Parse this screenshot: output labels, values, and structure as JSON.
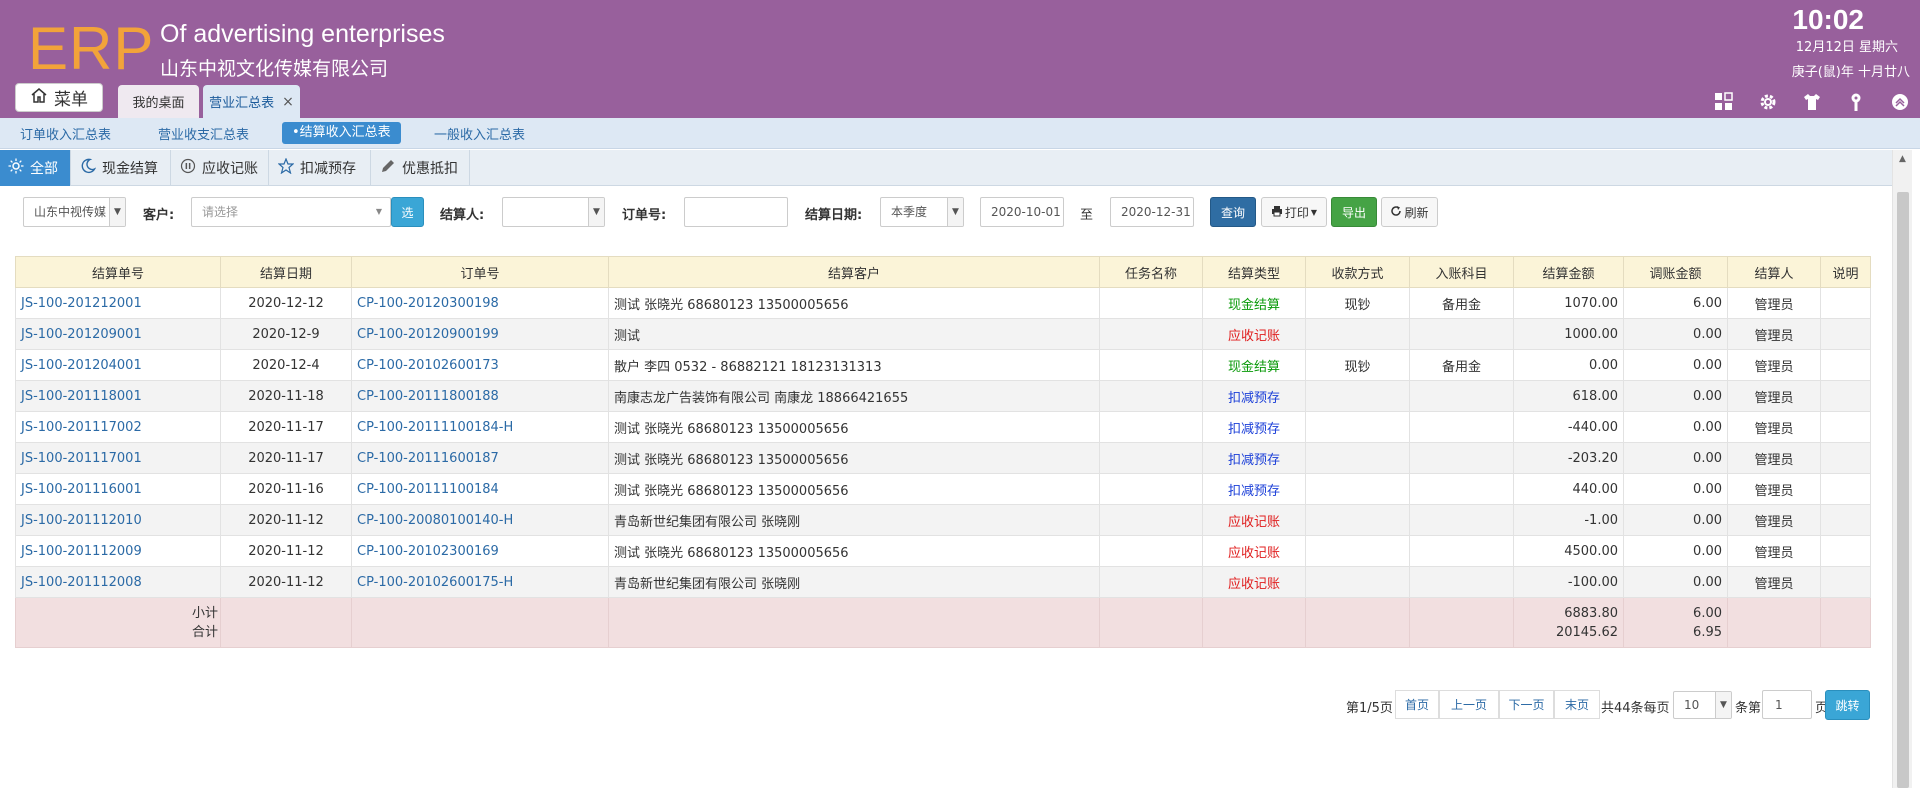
{
  "header": {
    "logo": "ERP",
    "company_en": "Of advertising enterprises",
    "company_cn": "山东中视文化传媒有限公司",
    "time": "10:02",
    "date": "12月12日 星期六",
    "lunar": "庚子(鼠)年 十月廿八",
    "menu_label": "菜单",
    "tabs": [
      {
        "label": "我的桌面"
      },
      {
        "label": "营业汇总表",
        "close": "×"
      }
    ],
    "icons": [
      "dashboard-icon",
      "gear-icon",
      "shirt-icon",
      "key-icon",
      "collapse-up-icon"
    ]
  },
  "subnav": {
    "items": [
      "订单收入汇总表",
      "营业收支汇总表",
      "•结算收入汇总表",
      "一般收入汇总表"
    ]
  },
  "filter_tabs": [
    "全部",
    "现金结算",
    "应收记账",
    "扣减预存",
    "优惠抵扣"
  ],
  "search": {
    "company_select": "山东中视传媒",
    "customer_label": "客户:",
    "customer_placeholder": "请选择",
    "select_button": "选",
    "settler_label": "结算人:",
    "settler_value": "",
    "order_label": "订单号:",
    "order_value": "",
    "date_label": "结算日期:",
    "period_value": "本季度",
    "date_from": "2020-10-01",
    "to_label": "至",
    "date_to": "2020-12-31",
    "query_button": "查询",
    "print_button": "打印",
    "export_button": "导出",
    "refresh_button": "刷新"
  },
  "table": {
    "columns": [
      "结算单号",
      "结算日期",
      "订单号",
      "结算客户",
      "任务名称",
      "结算类型",
      "收款方式",
      "入账科目",
      "结算金额",
      "调账金额",
      "结算人",
      "说明"
    ],
    "rows": [
      {
        "no": "JS-100-201212001",
        "date": "2020-12-12",
        "order": "CP-100-20120300198",
        "customer": "测试 张晓光 68680123 13500005656",
        "task": "",
        "type": "现金结算",
        "type_color": "green",
        "pay": "现钞",
        "account": "备用金",
        "amount": "1070.00",
        "adjust": "6.00",
        "person": "管理员",
        "note": ""
      },
      {
        "no": "JS-100-201209001",
        "date": "2020-12-9",
        "order": "CP-100-20120900199",
        "customer": "测试",
        "task": "",
        "type": "应收记账",
        "type_color": "red",
        "pay": "",
        "account": "",
        "amount": "1000.00",
        "adjust": "0.00",
        "person": "管理员",
        "note": ""
      },
      {
        "no": "JS-100-201204001",
        "date": "2020-12-4",
        "order": "CP-100-20102600173",
        "customer": "散户 李四 0532 - 86882121 18123131313",
        "task": "",
        "type": "现金结算",
        "type_color": "green",
        "pay": "现钞",
        "account": "备用金",
        "amount": "0.00",
        "adjust": "0.00",
        "person": "管理员",
        "note": ""
      },
      {
        "no": "JS-100-201118001",
        "date": "2020-11-18",
        "order": "CP-100-20111800188",
        "customer": "南康志龙广告装饰有限公司 南康龙 18866421655",
        "task": "",
        "type": "扣减预存",
        "type_color": "blue",
        "pay": "",
        "account": "",
        "amount": "618.00",
        "adjust": "0.00",
        "person": "管理员",
        "note": ""
      },
      {
        "no": "JS-100-201117002",
        "date": "2020-11-17",
        "order": "CP-100-20111100184-H",
        "customer": "测试 张晓光 68680123 13500005656",
        "task": "",
        "type": "扣减预存",
        "type_color": "blue",
        "pay": "",
        "account": "",
        "amount": "-440.00",
        "adjust": "0.00",
        "person": "管理员",
        "note": ""
      },
      {
        "no": "JS-100-201117001",
        "date": "2020-11-17",
        "order": "CP-100-20111600187",
        "customer": "测试 张晓光 68680123 13500005656",
        "task": "",
        "type": "扣减预存",
        "type_color": "blue",
        "pay": "",
        "account": "",
        "amount": "-203.20",
        "adjust": "0.00",
        "person": "管理员",
        "note": ""
      },
      {
        "no": "JS-100-201116001",
        "date": "2020-11-16",
        "order": "CP-100-20111100184",
        "customer": "测试 张晓光 68680123 13500005656",
        "task": "",
        "type": "扣减预存",
        "type_color": "blue",
        "pay": "",
        "account": "",
        "amount": "440.00",
        "adjust": "0.00",
        "person": "管理员",
        "note": ""
      },
      {
        "no": "JS-100-201112010",
        "date": "2020-11-12",
        "order": "CP-100-20080100140-H",
        "customer": "青岛新世纪集团有限公司 张晓刚",
        "task": "",
        "type": "应收记账",
        "type_color": "red",
        "pay": "",
        "account": "",
        "amount": "-1.00",
        "adjust": "0.00",
        "person": "管理员",
        "note": ""
      },
      {
        "no": "JS-100-201112009",
        "date": "2020-11-12",
        "order": "CP-100-20102300169",
        "customer": "测试 张晓光 68680123 13500005656",
        "task": "",
        "type": "应收记账",
        "type_color": "red",
        "pay": "",
        "account": "",
        "amount": "4500.00",
        "adjust": "0.00",
        "person": "管理员",
        "note": ""
      },
      {
        "no": "JS-100-201112008",
        "date": "2020-11-12",
        "order": "CP-100-20102600175-H",
        "customer": "青岛新世纪集团有限公司 张晓刚",
        "task": "",
        "type": "应收记账",
        "type_color": "red",
        "pay": "",
        "account": "",
        "amount": "-100.00",
        "adjust": "0.00",
        "person": "管理员",
        "note": ""
      }
    ],
    "summary": {
      "subtotal_label": "小计",
      "total_label": "合计",
      "subtotal_amount": "6883.80",
      "total_amount": "20145.62",
      "subtotal_adjust": "6.00",
      "total_adjust": "6.95"
    }
  },
  "pager": {
    "page_info": "第1/5页",
    "first": "首页",
    "prev": "上一页",
    "next": "下一页",
    "last": "末页",
    "total_text": "共44条每页",
    "page_size": "10",
    "items_text": "条第",
    "page_input": "1",
    "page_unit": "页",
    "go_button": "跳转"
  },
  "colors": {
    "header_bg": "#98609c",
    "logo": "#f2a33a",
    "accent_blue": "#3b8ccf",
    "link": "#2b6aa6"
  }
}
